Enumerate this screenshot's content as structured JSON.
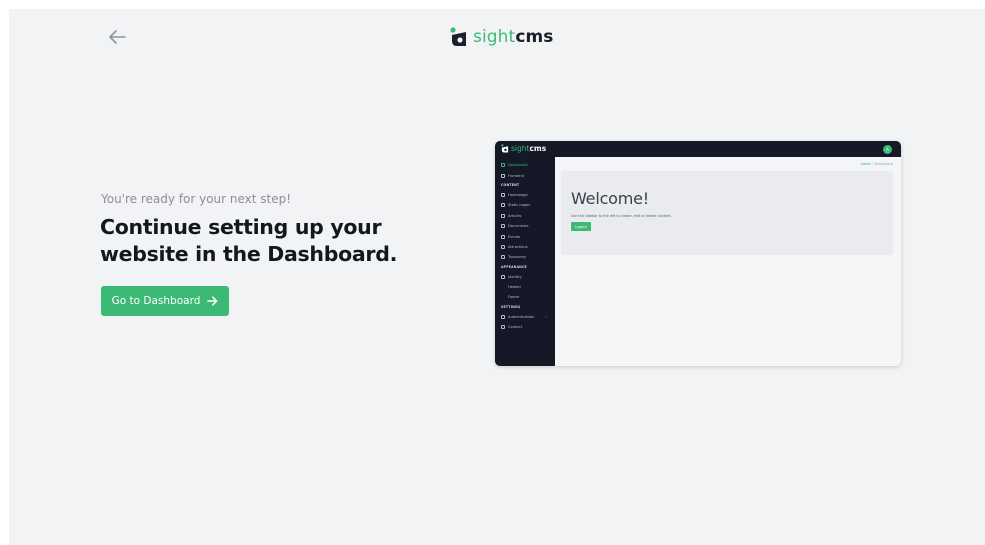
{
  "colors": {
    "accent": "#3cb974",
    "dark": "#141827",
    "background": "#f2f3f5"
  },
  "header": {
    "back_icon": "arrow-left-icon",
    "logo": {
      "icon": "sightcms-logo-icon",
      "part1": "sight",
      "part2": "cms"
    }
  },
  "main": {
    "subtitle": "You're ready for your next step!",
    "headline": "Continue setting up your website in the Dashboard.",
    "cta_label": "Go to Dashboard",
    "cta_icon": "arrow-right-icon"
  },
  "preview": {
    "logo": {
      "part1": "sight",
      "part2": "cms"
    },
    "avatar_initial": "A",
    "sidebar": [
      {
        "type": "item",
        "label": "Dashboard",
        "icon": "grid-icon",
        "active": true
      },
      {
        "type": "item",
        "label": "Frontend",
        "icon": "eye-icon"
      },
      {
        "type": "section",
        "label": "CONTENT"
      },
      {
        "type": "item",
        "label": "Homepage",
        "icon": "home-icon"
      },
      {
        "type": "item",
        "label": "Static pages",
        "icon": "page-icon"
      },
      {
        "type": "item",
        "label": "Articles",
        "icon": "article-icon"
      },
      {
        "type": "item",
        "label": "Documents",
        "icon": "document-icon"
      },
      {
        "type": "item",
        "label": "Events",
        "icon": "calendar-icon"
      },
      {
        "type": "item",
        "label": "Attractions",
        "icon": "attraction-icon"
      },
      {
        "type": "item",
        "label": "Taxonomy",
        "icon": "tag-icon"
      },
      {
        "type": "section",
        "label": "APPEARANCE"
      },
      {
        "type": "item",
        "label": "Identity",
        "icon": "brush-icon"
      },
      {
        "type": "item",
        "label": "Header",
        "icon": ""
      },
      {
        "type": "item",
        "label": "Footer",
        "icon": ""
      },
      {
        "type": "section",
        "label": "SETTINGS"
      },
      {
        "type": "item",
        "label": "Authentication",
        "icon": "key-icon",
        "chevron": "›"
      },
      {
        "type": "item",
        "label": "Contact",
        "icon": "contact-icon"
      }
    ],
    "breadcrumb": {
      "home": "Admin",
      "separator": "/",
      "current": "Dashboard"
    },
    "welcome": "Welcome!",
    "hint": "Use the sidebar to the left to create, edit or delete content.",
    "logout_label": "Logout"
  }
}
